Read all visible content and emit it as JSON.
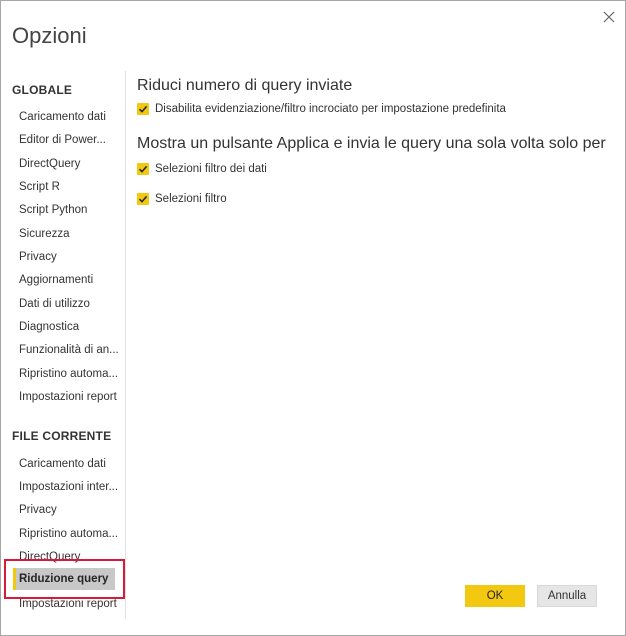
{
  "dialog": {
    "title": "Opzioni",
    "close_icon": "close-icon"
  },
  "sidebar": {
    "global_heading": "GLOBALE",
    "global_items": [
      {
        "label": "Caricamento dati"
      },
      {
        "label": "Editor di Power..."
      },
      {
        "label": "DirectQuery"
      },
      {
        "label": "Script R"
      },
      {
        "label": "Script Python"
      },
      {
        "label": "Sicurezza"
      },
      {
        "label": "Privacy"
      },
      {
        "label": "Aggiornamenti"
      },
      {
        "label": "Dati di utilizzo"
      },
      {
        "label": "Diagnostica"
      },
      {
        "label": "Funzionalità di an..."
      },
      {
        "label": "Ripristino automa..."
      },
      {
        "label": "Impostazioni report"
      }
    ],
    "file_heading": "FILE CORRENTE",
    "file_items": [
      {
        "label": "Caricamento dati"
      },
      {
        "label": "Impostazioni inter..."
      },
      {
        "label": "Privacy"
      },
      {
        "label": "Ripristino automa..."
      },
      {
        "label": "DirectQuery"
      },
      {
        "label": "Riduzione query",
        "selected": true
      },
      {
        "label": "Impostazioni report"
      }
    ],
    "accent_color": "#f2c811",
    "highlight_color": "#d9193a"
  },
  "main": {
    "section1_heading": "Riduci numero di query inviate",
    "section1_option": {
      "label": "Disabilita evidenziazione/filtro incrociato per impostazione predefinita",
      "checked": true
    },
    "section2_heading": "Mostra un pulsante Applica e invia le query una sola volta solo per",
    "section2_options": [
      {
        "label": "Selezioni filtro dei dati",
        "checked": true
      },
      {
        "label": "Selezioni filtro",
        "checked": true
      }
    ]
  },
  "footer": {
    "ok_label": "OK",
    "cancel_label": "Annulla"
  }
}
